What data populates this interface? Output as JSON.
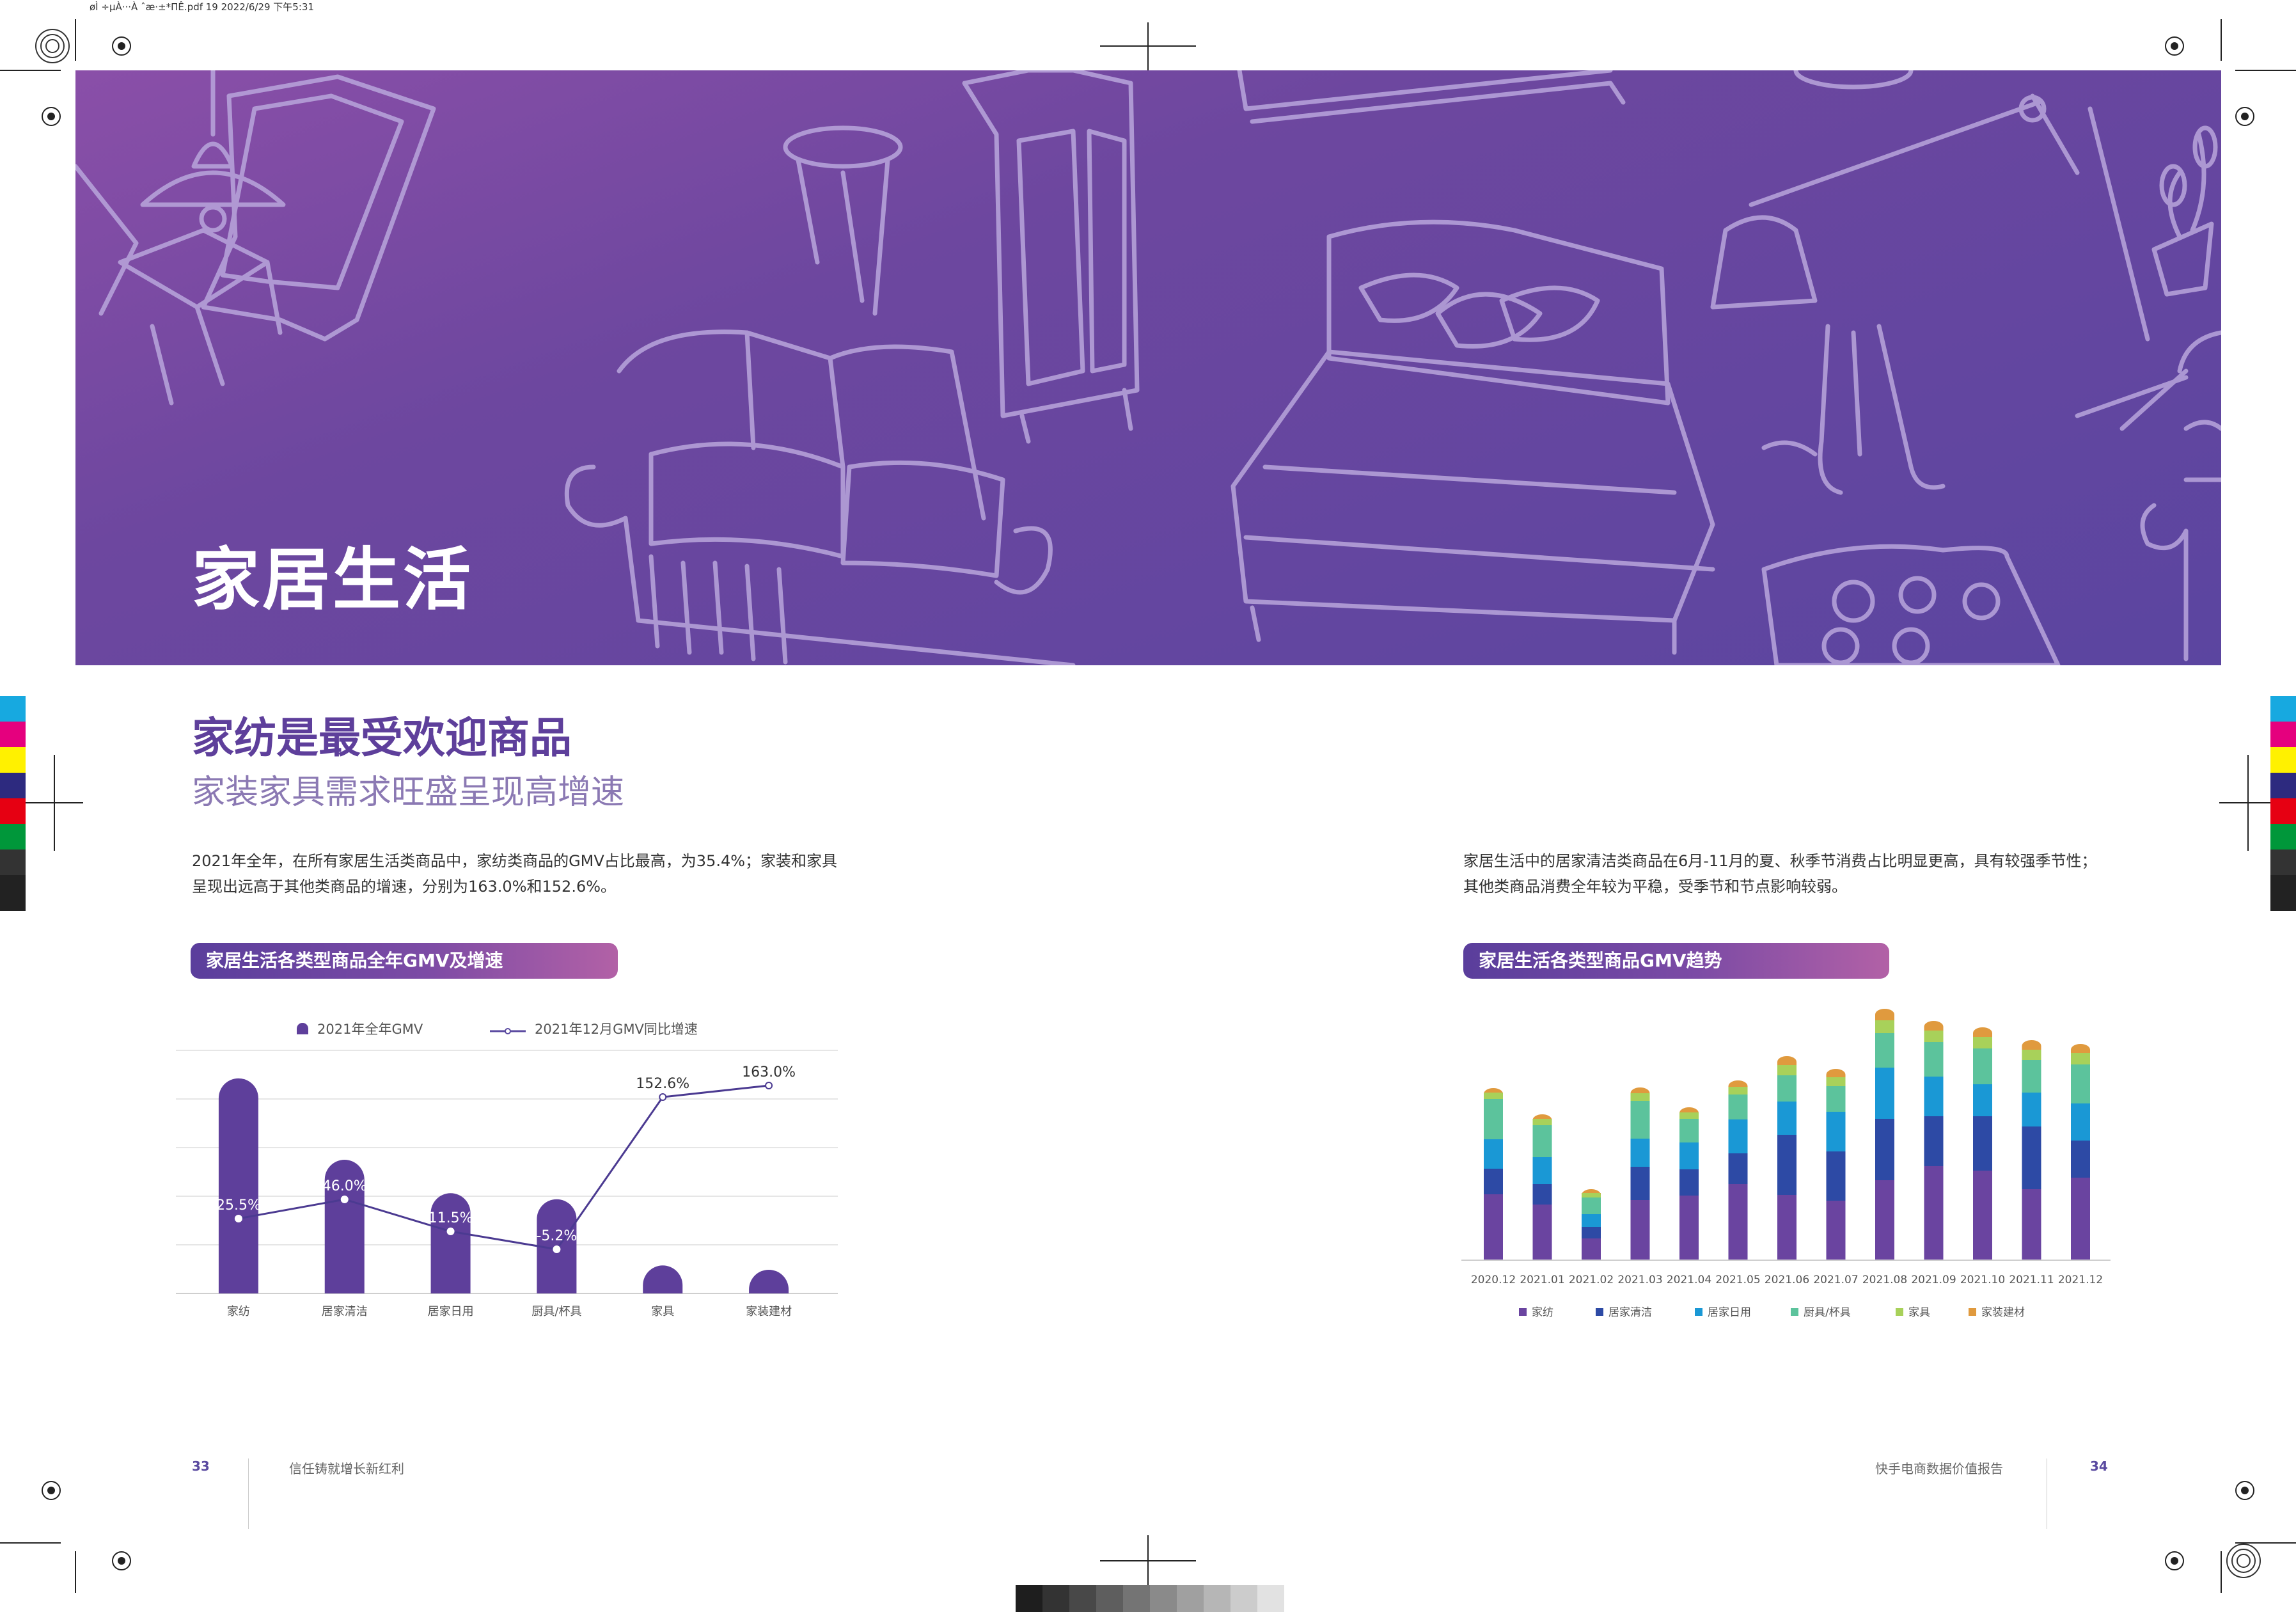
{
  "print_header": "øÌ ÷µÀ···À ˆæ·±*ΠÊ.pdf  19  2022/6/29  下午5:31",
  "hero": {
    "title": "家居生活"
  },
  "section": {
    "title": "家纺是最受欢迎商品",
    "subtitle": "家装家具需求旺盛呈现高增速"
  },
  "left_paragraph": "2021年全年，在所有家居生活类商品中，家纺类商品的GMV占比最高，为35.4%；家装和家具呈现出远高于其他类商品的增速，分别为163.0%和152.6%。",
  "right_paragraph": "家居生活中的居家清洁类商品在6月-11月的夏、秋季节消费占比明显更高，具有较强季节性；其他类商品消费全年较为平稳，受季节和节点影响较弱。",
  "left_chart_title": "家居生活各类型商品全年GMV及增速",
  "right_chart_title": "家居生活各类型商品GMV趋势",
  "footer": {
    "left_page": "33",
    "left_text": "信任铸就增长新红利",
    "right_text": "快手电商数据价值报告",
    "right_page": "34"
  },
  "colors": {
    "purple": "#5e3f9b",
    "家纺": "#6a44a0",
    "居家清洁": "#2d4aa5",
    "居家日用": "#1a98d5",
    "厨具/杯具": "#5cc39c",
    "家具": "#a8d15a",
    "家装建材": "#e09a3e"
  },
  "chart_data": [
    {
      "type": "bar",
      "title": "家居生活各类型商品全年GMV及增速",
      "categories": [
        "家纺",
        "居家清洁",
        "居家日用",
        "厨具/杯具",
        "家具",
        "家装建材"
      ],
      "series": [
        {
          "name": "2021年全年GMV",
          "type": "bar",
          "values": [
            35.4,
            22.0,
            16.5,
            15.5,
            4.6,
            3.9
          ]
        },
        {
          "name": "2021年12月GMV同比增速",
          "type": "line",
          "values": [
            25.5,
            46.0,
            11.5,
            -5.2,
            152.6,
            163.0
          ],
          "labels": [
            "25.5%",
            "46.0%",
            "11.5%",
            "-5.2%",
            "152.6%",
            "163.0%"
          ]
        }
      ],
      "legend_position": "top",
      "grid": true
    },
    {
      "type": "bar",
      "stacked": true,
      "title": "家居生活各类型商品GMV趋势",
      "categories": [
        "2020.12",
        "2021.01",
        "2021.02",
        "2021.03",
        "2021.04",
        "2021.05",
        "2021.06",
        "2021.07",
        "2021.08",
        "2021.09",
        "2021.10",
        "2021.11",
        "2021.12"
      ],
      "series": [
        {
          "name": "家纺",
          "values": [
            102,
            86,
            33,
            93,
            100,
            118,
            101,
            92,
            124,
            146,
            139,
            110,
            128
          ]
        },
        {
          "name": "居家清洁",
          "values": [
            40,
            32,
            18,
            52,
            41,
            48,
            94,
            77,
            96,
            78,
            85,
            98,
            58
          ]
        },
        {
          "name": "居家日用",
          "values": [
            46,
            42,
            20,
            44,
            42,
            53,
            52,
            62,
            80,
            62,
            50,
            53,
            58
          ]
        },
        {
          "name": "厨具/杯具",
          "values": [
            63,
            50,
            26,
            59,
            37,
            39,
            41,
            40,
            54,
            54,
            56,
            51,
            61
          ]
        },
        {
          "name": "家具",
          "values": [
            10,
            10,
            7,
            12,
            10,
            12,
            16,
            14,
            20,
            18,
            18,
            16,
            18
          ]
        },
        {
          "name": "家装建材",
          "values": [
            7,
            7,
            6,
            9,
            8,
            10,
            14,
            13,
            18,
            15,
            15,
            15,
            14
          ]
        }
      ],
      "legend_position": "bottom",
      "grid": false
    }
  ]
}
